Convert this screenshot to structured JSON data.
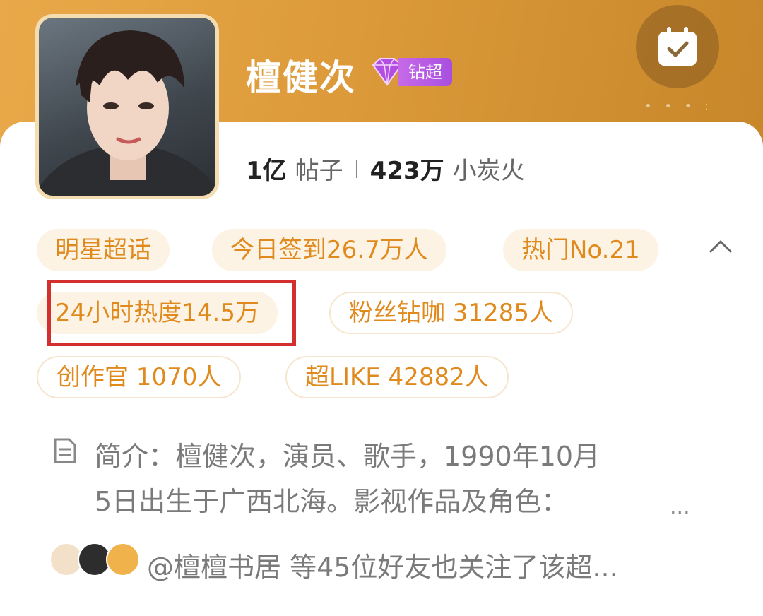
{
  "header": {
    "title": "檀健次",
    "badge_label": "钻超",
    "badge_level": "2",
    "checkin_icon": "calendar-check-icon"
  },
  "stats": {
    "posts_value": "1亿",
    "posts_label": "帖子",
    "fans_value": "423万",
    "fans_label": "小炭火"
  },
  "tags": [
    "明星超话",
    "今日签到26.7万人",
    "热门No.21",
    "24小时热度14.5万",
    "粉丝钻咖 31285人",
    "创作官 1070人",
    "超LIKE 42882人"
  ],
  "intro": {
    "line1": "简介：檀健次，演员、歌手，1990年10月",
    "line2": "5日出生于广西北海。影视作品及角色：",
    "ellipsis": "...",
    "icon": "document-icon"
  },
  "friends": {
    "text": "@檀檀书居 等45位好友也关注了该超..."
  },
  "colors": {
    "header_gradient_start": "#e9a94a",
    "header_gradient_end": "#c7872a",
    "tag_text": "#e08a1e",
    "tag_bg": "#fdf3e4",
    "highlight": "#d32f2f",
    "badge": "#b65ce4"
  }
}
